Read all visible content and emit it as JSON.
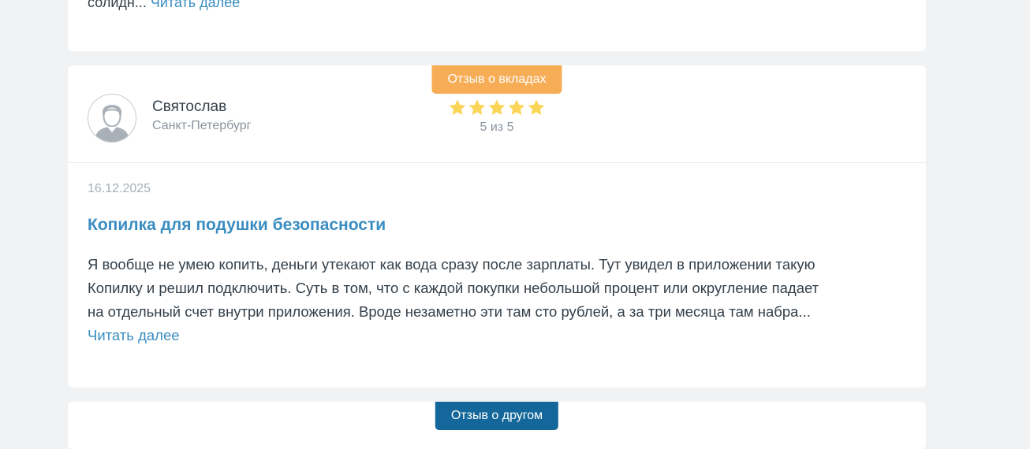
{
  "previous_review": {
    "text_fragment": "солидн...",
    "read_more": "Читать далее"
  },
  "review": {
    "category_badge": "Отзыв о вкладах",
    "author": {
      "name": "Святослав",
      "city": "Санкт-Петербург",
      "avatar_icon": "user-avatar-icon"
    },
    "rating": {
      "value": 5,
      "max": 5,
      "label": "5 из 5",
      "star_icon": "star-icon",
      "star_color": "#fbd557"
    },
    "date": "16.12.2025",
    "title": "Копилка для подушки безопасности",
    "text_lines": [
      "Я вообще не умею копить, деньги утекают как вода сразу после зарплаты. Тут увидел в приложении такую",
      "Копилку и решил подключить. Суть в том, что с каждой покупки небольшой процент или округление падает",
      "на отдельный счет внутри приложения. Вроде незаметно эти там сто рублей, а за три месяца там набра..."
    ],
    "read_more": "Читать далее"
  },
  "next_review": {
    "category_badge": "Отзыв о другом"
  },
  "colors": {
    "background": "#f0f2f4",
    "card": "#ffffff",
    "accent_link": "#3a8dc1",
    "badge_deposits": "#f7ad56",
    "badge_other": "#14679a",
    "muted_text": "#8a949d"
  }
}
